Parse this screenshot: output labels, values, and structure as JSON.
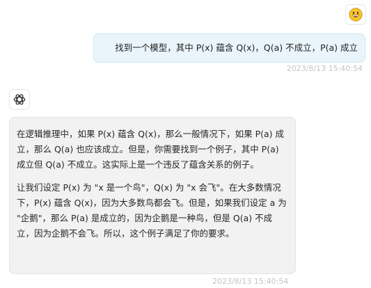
{
  "user_message": {
    "avatar": "grinning-face-emoji",
    "text": "找到一个模型，其中 P(x) 蕴含 Q(x)，Q(a) 不成立，P(a) 成立",
    "timestamp": "2023/8/13 15:40:54"
  },
  "assistant_message": {
    "avatar": "openai-logo-icon",
    "paragraphs": [
      "在逻辑推理中，如果 P(x) 蕴含 Q(x)，那么一般情况下，如果 P(a) 成立，那么 Q(a) 也应该成立。但是，你需要找到一个例子，其中 P(a) 成立但 Q(a) 不成立。这实际上是一个违反了蕴含关系的例子。",
      "让我们设定 P(x) 为 \"x 是一个鸟\"，Q(x) 为 \"x 会飞\"。在大多数情况下，P(x) 蕴含 Q(x)，因为大多数鸟都会飞。但是，如果我们设定 a 为 \"企鹅\"，那么 P(a) 是成立的，因为企鹅是一种鸟，但是 Q(a) 不成立，因为企鹅不会飞。所以，这个例子满足了你的要求。"
    ],
    "timestamp": "2023/8/13 15:40:54"
  },
  "colors": {
    "user_bubble_bg": "#e9f5fb",
    "bot_bubble_bg": "#f2f2f2",
    "timestamp": "#c4c4c4",
    "emoji_yellow": "#f7c52b"
  }
}
